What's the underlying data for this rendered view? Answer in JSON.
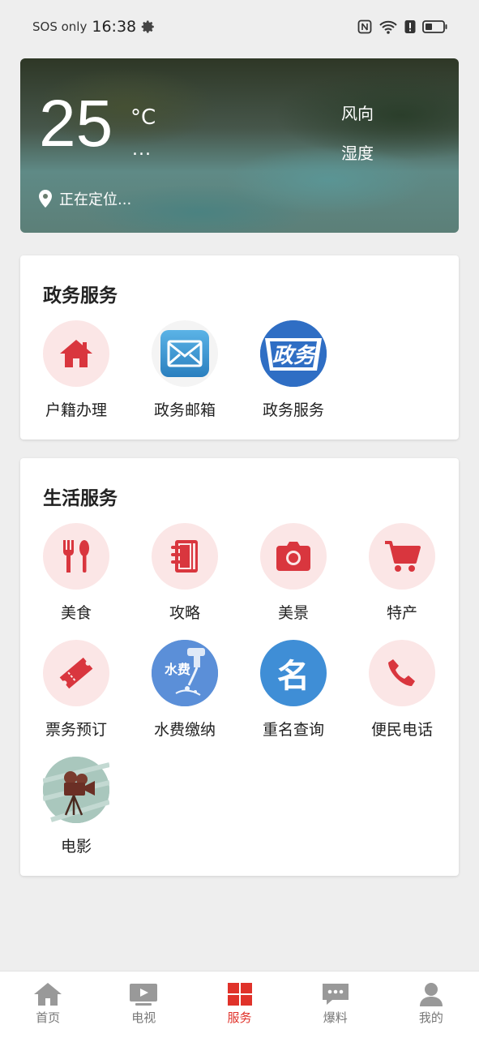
{
  "status_bar": {
    "carrier": "SOS only",
    "time": "16:38"
  },
  "weather": {
    "temperature": "25",
    "unit": "°C",
    "condition": "...",
    "wind_label": "风向",
    "humidity_label": "湿度",
    "location": "正在定位..."
  },
  "gov_services": {
    "title": "政务服务",
    "items": [
      {
        "label": "户籍办理",
        "icon": "home-icon"
      },
      {
        "label": "政务邮箱",
        "icon": "mail-icon"
      },
      {
        "label": "政务服务",
        "icon": "gov-service-logo-icon",
        "logo_text": "政务"
      }
    ]
  },
  "life_services": {
    "title": "生活服务",
    "items": [
      {
        "label": "美食",
        "icon": "cutlery-icon"
      },
      {
        "label": "攻略",
        "icon": "notebook-icon"
      },
      {
        "label": "美景",
        "icon": "camera-icon"
      },
      {
        "label": "特产",
        "icon": "cart-icon"
      },
      {
        "label": "票务预订",
        "icon": "ticket-icon"
      },
      {
        "label": "水费缴纳",
        "icon": "water-fee-icon",
        "logo_text": "水费"
      },
      {
        "label": "重名查询",
        "icon": "name-search-icon",
        "logo_text": "名"
      },
      {
        "label": "便民电话",
        "icon": "phone-icon"
      },
      {
        "label": "电影",
        "icon": "film-camera-icon"
      }
    ]
  },
  "bottom_nav": {
    "items": [
      {
        "label": "首页",
        "icon": "home-nav-icon"
      },
      {
        "label": "电视",
        "icon": "tv-icon"
      },
      {
        "label": "服务",
        "icon": "services-grid-icon",
        "active": true
      },
      {
        "label": "爆料",
        "icon": "chat-bubble-icon"
      },
      {
        "label": "我的",
        "icon": "user-icon"
      }
    ]
  },
  "colors": {
    "accent": "#e0322a",
    "icon_bg": "#fbe6e6",
    "nav_inactive": "#999999"
  }
}
